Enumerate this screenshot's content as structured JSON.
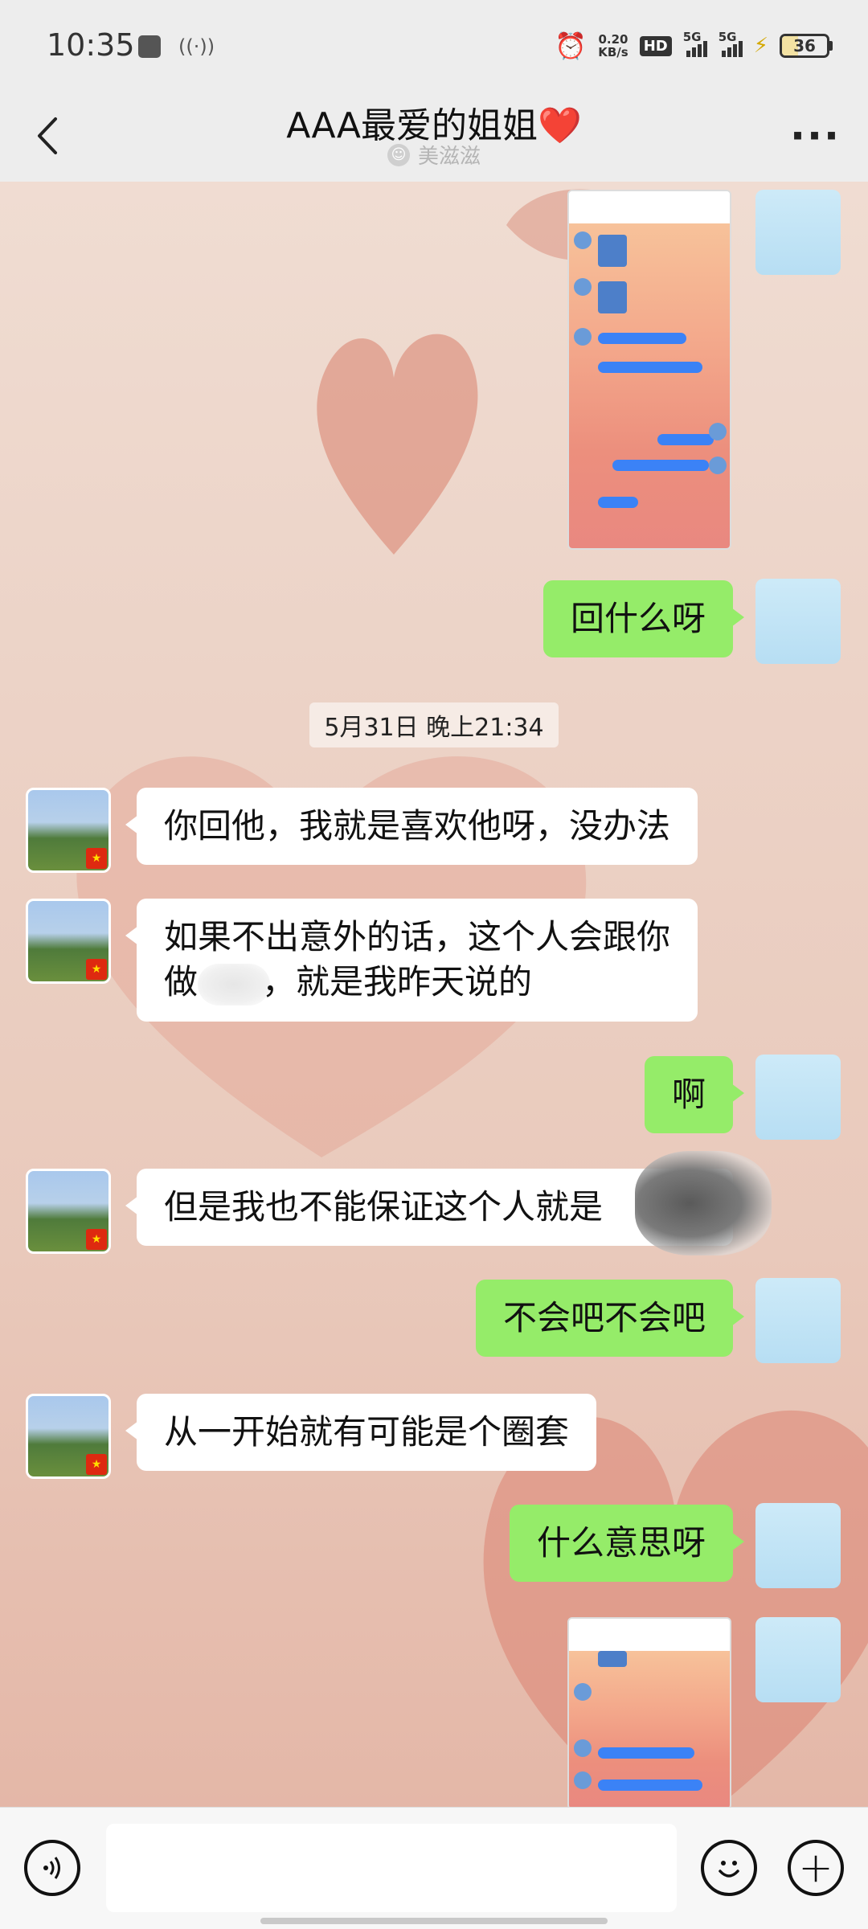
{
  "status_bar": {
    "time": "10:35",
    "net_speed_value": "0.20",
    "net_speed_unit": "KB/s",
    "hd_label": "HD",
    "sim1_label": "5G",
    "sim2_label": "5G",
    "battery_level": "36",
    "battery_fraction": 0.36
  },
  "header": {
    "back_icon": "chevron-left-icon",
    "title": "AAA最爱的姐姐",
    "title_emoji": "❤️",
    "subtitle": "美滋滋",
    "more_icon": "more-dots-icon"
  },
  "chat": {
    "timestamp": "5月31日 晚上21:34",
    "messages": [
      {
        "from": "me",
        "type": "image"
      },
      {
        "from": "me",
        "type": "text",
        "text": "回什么呀"
      },
      {
        "from": "other",
        "type": "text",
        "text": "你回他，我就是喜欢他呀，没办法"
      },
      {
        "from": "other",
        "type": "text",
        "line1": "如果不出意外的话，这个人会跟你",
        "line2_prefix": "做",
        "line2_suffix": "，就是我昨天说的"
      },
      {
        "from": "me",
        "type": "text",
        "text": "啊"
      },
      {
        "from": "other",
        "type": "text",
        "text": "但是我也不能保证这个人就是"
      },
      {
        "from": "me",
        "type": "text",
        "text": "不会吧不会吧"
      },
      {
        "from": "other",
        "type": "text",
        "text": "从一开始就有可能是个圈套"
      },
      {
        "from": "me",
        "type": "text",
        "text": "什么意思呀"
      },
      {
        "from": "me",
        "type": "image"
      }
    ]
  },
  "input_bar": {
    "voice_icon": "voice-icon",
    "emoji_icon": "emoji-icon",
    "plus_icon": "plus-icon",
    "plus_glyph": "+"
  }
}
